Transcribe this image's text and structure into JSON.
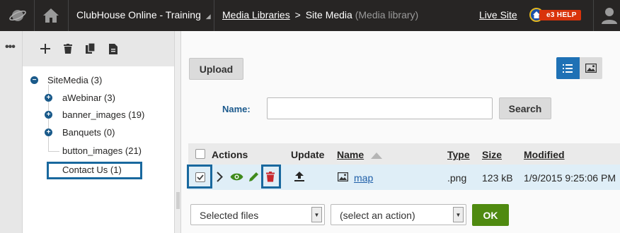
{
  "header": {
    "site_name": "ClubHouse Online - Training",
    "breadcrumb_root": "Media Libraries",
    "breadcrumb_separator": ">",
    "breadcrumb_current": "Site Media",
    "breadcrumb_type": "(Media library)",
    "live_site": "Live Site",
    "help_label": "e3 HELP"
  },
  "tree": {
    "root": "SiteMedia (3)",
    "items": [
      {
        "label": "aWebinar (3)"
      },
      {
        "label": "banner_images (19)"
      },
      {
        "label": "Banquets (0)"
      },
      {
        "label": "button_images (21)"
      },
      {
        "label": "Contact Us (1)"
      }
    ]
  },
  "toolbar": {
    "upload_label": "Upload",
    "name_label": "Name:",
    "search_label": "Search"
  },
  "grid": {
    "headers": {
      "actions": "Actions",
      "update": "Update",
      "name": "Name",
      "type": "Type",
      "size": "Size",
      "modified": "Modified"
    },
    "rows": [
      {
        "name": "map",
        "type": ".png",
        "size": "123 kB",
        "modified": "1/9/2015 9:25:06 PM",
        "checked": true
      }
    ]
  },
  "footer": {
    "scope_select": "Selected files",
    "action_select": "(select an action)",
    "ok_label": "OK"
  },
  "colors": {
    "accent": "#1f71b5",
    "ok_green": "#4f8a10",
    "delete_red": "#c8282d",
    "view_green": "#3f8a1c"
  }
}
